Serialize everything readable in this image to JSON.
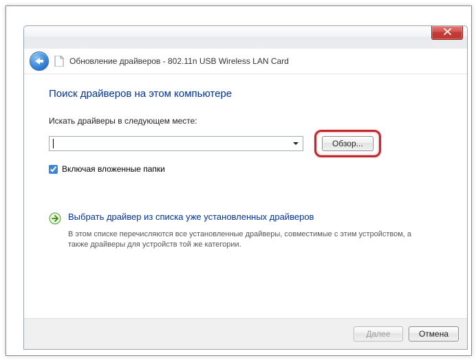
{
  "window": {
    "title_prefix": "Обновление драйверов",
    "title_device": "802.11n USB Wireless LAN Card"
  },
  "page": {
    "heading": "Поиск драйверов на этом компьютере",
    "search_label": "Искать драйверы в следующем месте:",
    "path_value": "",
    "browse_label": "Обзор...",
    "include_subfolders_label": "Включая вложенные папки",
    "include_subfolders_checked": true
  },
  "pick_link": {
    "title": "Выбрать драйвер из списка уже установленных драйверов",
    "desc": "В этом списке перечисляются все установленные драйверы, совместимые с этим устройством, а также драйверы для устройств той же категории."
  },
  "footer": {
    "next_label": "Далее",
    "cancel_label": "Отмена"
  },
  "colors": {
    "accent_link": "#003399",
    "highlight_border": "#c1272d"
  }
}
